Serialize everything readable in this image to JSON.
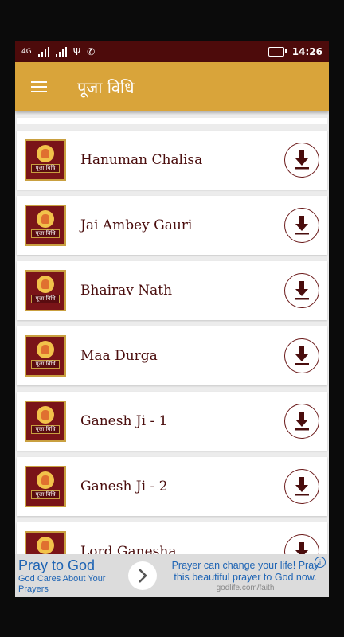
{
  "status": {
    "network": "4G",
    "time": "14:26"
  },
  "appbar": {
    "title": "पूजा विधि"
  },
  "thumb_caption": "पूजा विधि",
  "items": [
    {
      "label": "Hanuman Chalisa"
    },
    {
      "label": "Jai Ambey Gauri"
    },
    {
      "label": "Bhairav Nath"
    },
    {
      "label": "Maa Durga"
    },
    {
      "label": "Ganesh Ji - 1"
    },
    {
      "label": "Ganesh Ji - 2"
    },
    {
      "label": "Lord Ganesha"
    }
  ],
  "ad": {
    "headline": "Pray to God",
    "sub": "God Cares About Your Prayers",
    "message": "Prayer can change your life! Pray this beautiful prayer to God now.",
    "url": "godlife.com/faith",
    "info": "i"
  },
  "colors": {
    "statusbar": "#4d0b0b",
    "appbar": "#d9a43a",
    "accent": "#4a0d0d",
    "ad_text": "#1e64b4"
  }
}
